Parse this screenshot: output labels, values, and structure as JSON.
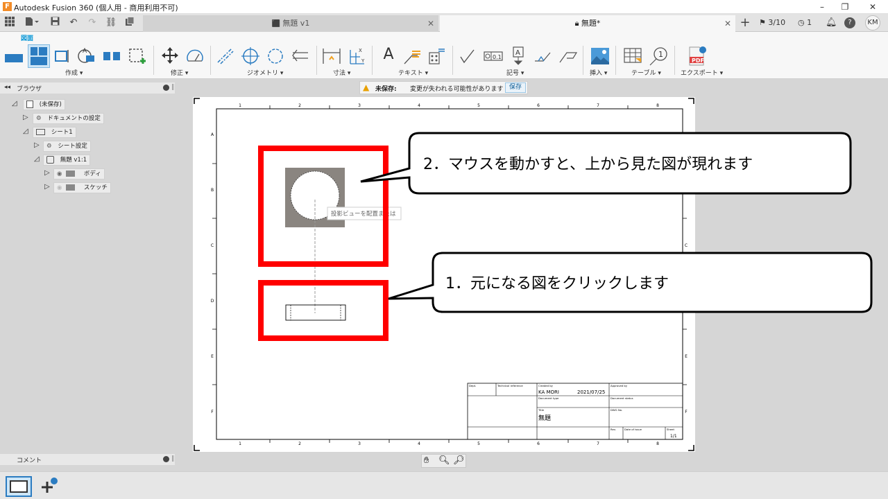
{
  "window": {
    "title": "Autodesk Fusion 360 (個人用 - 商用利用不可)",
    "logo": "F"
  },
  "tabs": [
    {
      "label": "無題 v1",
      "active": false
    },
    {
      "label": "無題*",
      "active": true
    }
  ],
  "header_right": {
    "jobs": "3/10",
    "online": "1",
    "avatar": "KM"
  },
  "toolbar": {
    "active_workspace": "図面",
    "groups": [
      {
        "label": "作成 ▾"
      },
      {
        "label": "修正 ▾"
      },
      {
        "label": "ジオメトリ ▾"
      },
      {
        "label": "寸法 ▾"
      },
      {
        "label": "テキスト ▾"
      },
      {
        "label": "記号 ▾"
      },
      {
        "label": "挿入 ▾"
      },
      {
        "label": "テーブル ▾"
      },
      {
        "label": "エクスポート ▾"
      }
    ]
  },
  "browser": {
    "title": "ブラウザ",
    "items": [
      {
        "label": "(未保存)"
      },
      {
        "label": "ドキュメントの設定"
      },
      {
        "label": "シート1"
      },
      {
        "label": "シート設定"
      },
      {
        "label": "無題 v1:1"
      },
      {
        "label": "ボディ"
      },
      {
        "label": "スケッチ"
      }
    ]
  },
  "comments": {
    "title": "コメント"
  },
  "warning": {
    "label": "未保存:",
    "message": "変更が失われる可能性があります",
    "save_button": "保存"
  },
  "sheet": {
    "col_labels": [
      "1",
      "2",
      "3",
      "4",
      "5",
      "6",
      "7",
      "8"
    ],
    "row_labels": [
      "A",
      "B",
      "C",
      "D",
      "E",
      "F"
    ],
    "tooltip": "投影ビューを配置または",
    "title_block": {
      "dept": "Dept.",
      "technical_reference": "Technical reference",
      "created_by_label": "Created by",
      "created_by": "KA MORI",
      "date": "2021/07/25",
      "approved_by": "Approved by",
      "document_type": "Document type",
      "document_status": "Document status",
      "title_label": "Title",
      "title": "無題",
      "dwg_no": "DWG No.",
      "rev": "Rev.",
      "date_of_issue": "Date of issue",
      "sheet_label": "Sheet",
      "sheet": "1/1"
    }
  },
  "callouts": [
    {
      "text": "2．マウスを動かすと、上から見た図が現れます"
    },
    {
      "text": "1．元になる図をクリックします"
    }
  ],
  "colors": {
    "accent": "#0696d7",
    "highlight_red": "#ff0000",
    "view_fill": "#8a8580"
  }
}
